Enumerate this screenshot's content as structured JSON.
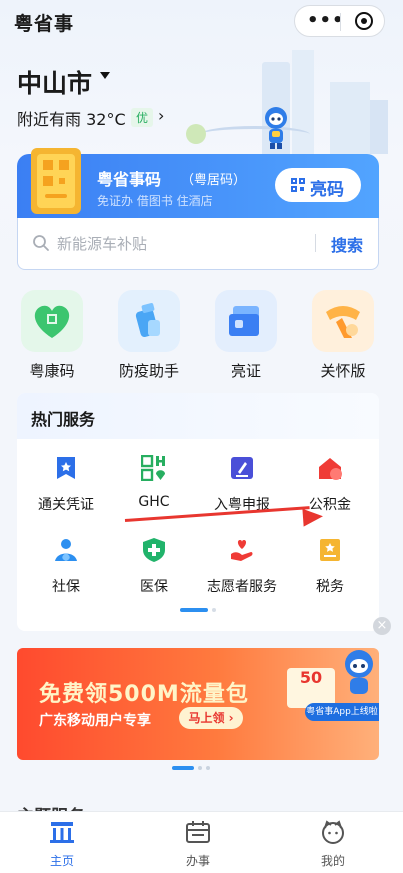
{
  "app": {
    "title": "粤省事"
  },
  "capsule": {
    "more": "•••"
  },
  "location": {
    "city": "中山市",
    "weather": "附近有雨 32°C",
    "aqi": "优",
    "arrow": "›"
  },
  "code_card": {
    "title": "粤省事码",
    "subtitle": "（粤居码）",
    "desc": "免证办 借图书 住酒店",
    "button": "亮码",
    "accent": "#3b7ff3"
  },
  "search": {
    "placeholder": "新能源车补贴",
    "button": "搜索"
  },
  "quick_actions": [
    {
      "label": "粤康码",
      "icon": "health-code-icon",
      "color": "#3cc56f"
    },
    {
      "label": "防疫助手",
      "icon": "epidemic-assistant-icon",
      "color": "#4aa6f5"
    },
    {
      "label": "亮证",
      "icon": "license-cards-icon",
      "color": "#3b7ff3"
    },
    {
      "label": "关怀版",
      "icon": "care-scarf-icon",
      "color": "#ff9a2e"
    }
  ],
  "hot_services": {
    "title": "热门服务",
    "items": [
      {
        "label": "通关凭证",
        "icon": "customs-voucher-icon"
      },
      {
        "label": "GHC",
        "icon": "ghc-icon"
      },
      {
        "label": "入粤申报",
        "icon": "entry-declare-icon"
      },
      {
        "label": "公积金",
        "icon": "housing-fund-icon"
      },
      {
        "label": "社保",
        "icon": "social-security-icon"
      },
      {
        "label": "医保",
        "icon": "medical-insurance-icon"
      },
      {
        "label": "志愿者服务",
        "icon": "volunteer-icon"
      },
      {
        "label": "税务",
        "icon": "tax-icon"
      }
    ]
  },
  "banner": {
    "title": "免费领500M流量包",
    "subtitle": "广东移动用户专享",
    "button": "马上领 ›",
    "coupon": "50",
    "tag": "粤省事App上线啦"
  },
  "close": "×",
  "section_peek": "主题服务",
  "tabbar": [
    {
      "label": "主页",
      "icon": "home-icon",
      "active": true
    },
    {
      "label": "办事",
      "icon": "calendar-icon",
      "active": false
    },
    {
      "label": "我的",
      "icon": "profile-icon",
      "active": false
    }
  ]
}
